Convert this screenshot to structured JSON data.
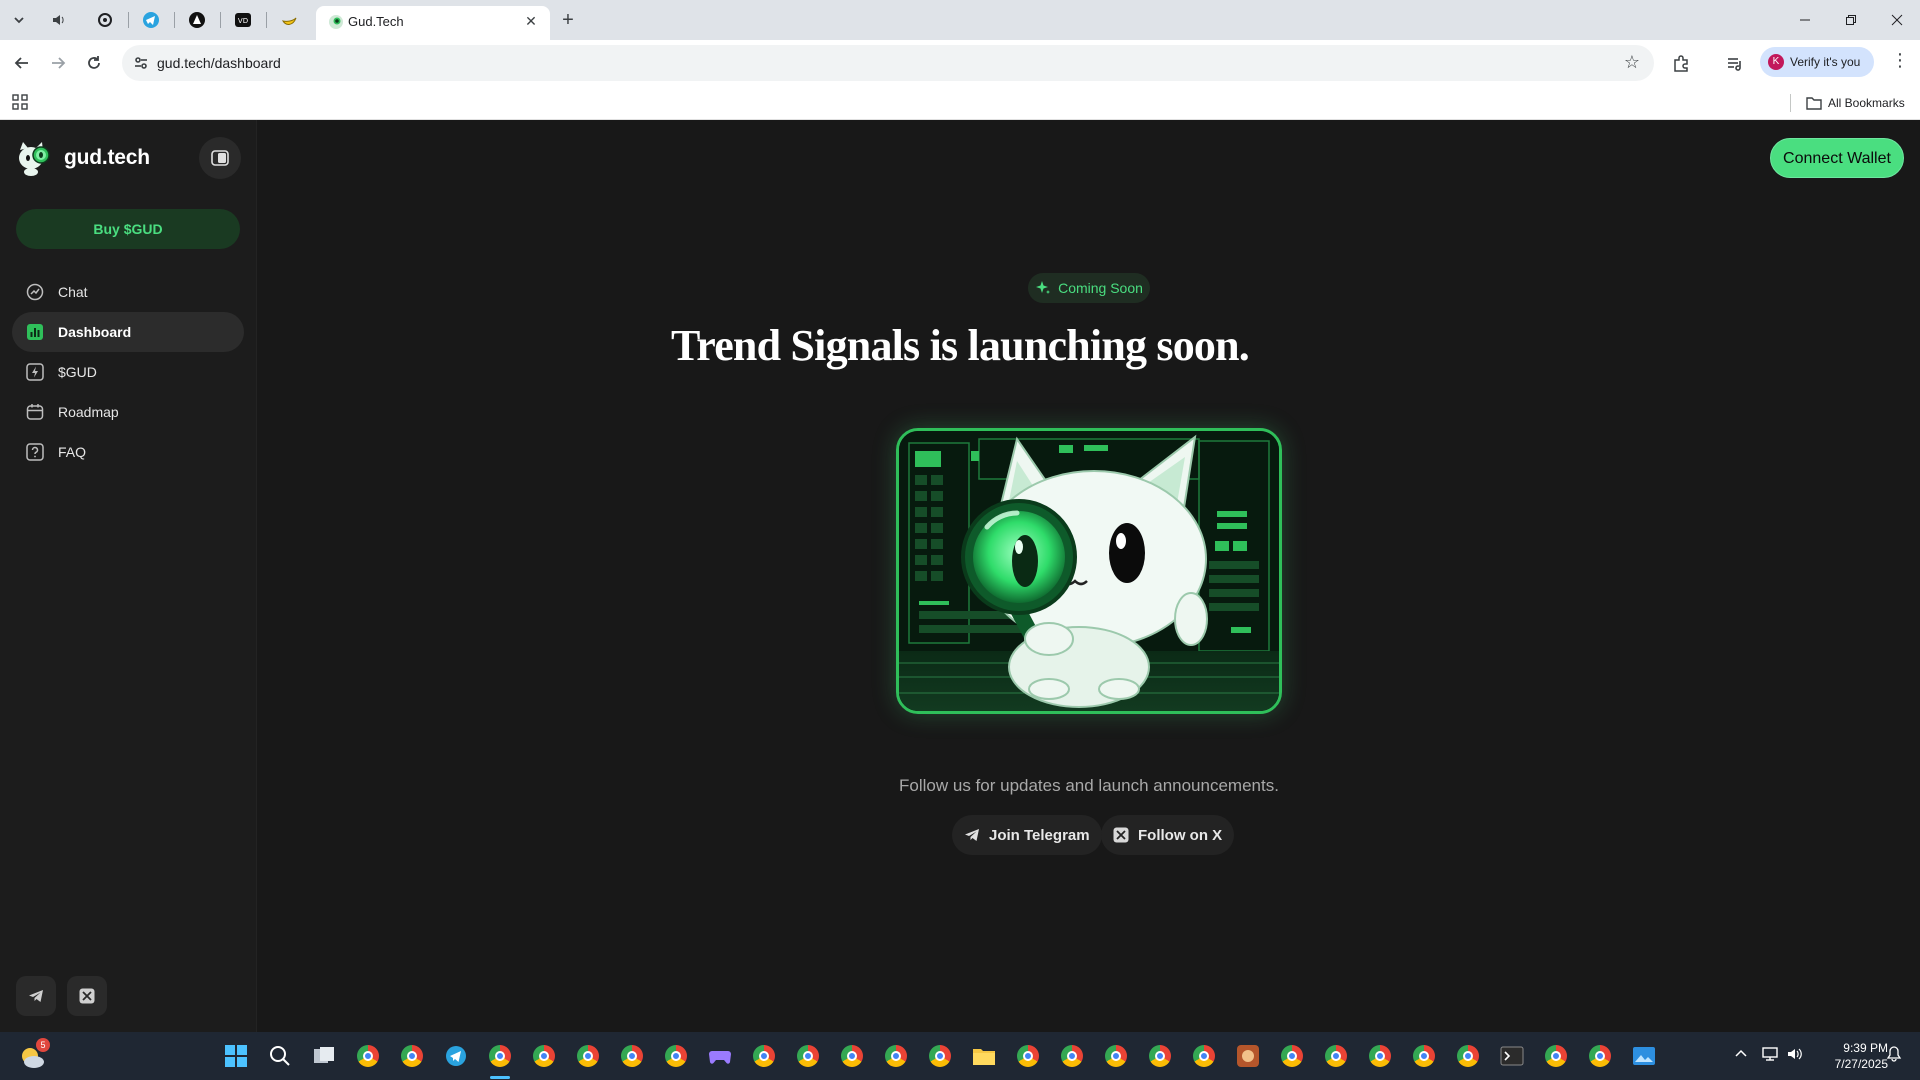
{
  "browser": {
    "active_tab_title": "Gud.Tech",
    "url": "gud.tech/dashboard",
    "profile_initial": "K",
    "verify_label": "Verify it's you",
    "bookmarks_label": "All Bookmarks",
    "new_tab_symbol": "+",
    "close_symbol": "✕"
  },
  "sidebar": {
    "brand": "gud.tech",
    "buy_label": "Buy $GUD",
    "items": [
      {
        "label": "Chat",
        "icon": "chat-icon",
        "active": false
      },
      {
        "label": "Dashboard",
        "icon": "chart-bar-icon",
        "active": true
      },
      {
        "label": "$GUD",
        "icon": "bolt-icon",
        "active": false
      },
      {
        "label": "Roadmap",
        "icon": "calendar-icon",
        "active": false
      },
      {
        "label": "FAQ",
        "icon": "question-icon",
        "active": false
      }
    ]
  },
  "header": {
    "connect_label": "Connect Wallet"
  },
  "main": {
    "badge": "Coming Soon",
    "headline": "Trend Signals is launching soon.",
    "follow_text": "Follow us for updates and launch announcements.",
    "telegram_label": "Join Telegram",
    "x_label": "Follow on X"
  },
  "taskbar": {
    "notification_count": "5",
    "time": "9:39 PM",
    "date": "7/27/2025"
  },
  "colors": {
    "accent": "#4ade80",
    "background": "#181818",
    "sidebar": "#1c1c1c"
  }
}
